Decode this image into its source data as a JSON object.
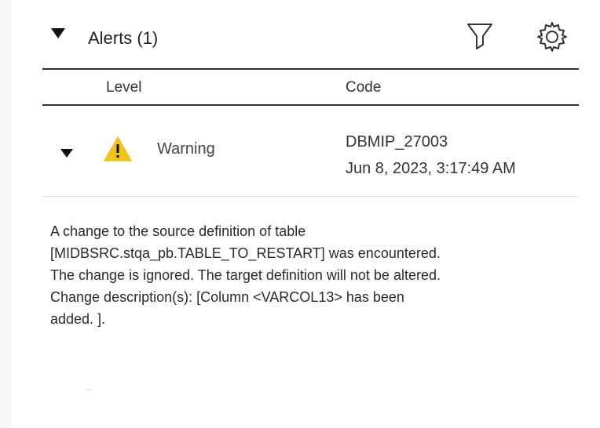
{
  "header": {
    "title": "Alerts (1)",
    "collapse_icon": "caret-down-icon",
    "filter_icon": "filter-icon",
    "settings_icon": "gear-icon"
  },
  "columns": {
    "level": "Level",
    "code": "Code"
  },
  "alerts": [
    {
      "level": "Warning",
      "code": "DBMIP_27003",
      "time": "Jun 8, 2023, 3:17:49 AM",
      "level_icon": "warning-icon",
      "message": "A change to the source definition of table [MIDBSRC.stqa_pb.TABLE_TO_RESTART] was encountered. The change is ignored. The target definition will not be altered. Change description(s): [Column <VARCOL13> has been added. ]."
    }
  ],
  "colors": {
    "warning": "#f0c419",
    "divider": "#333333",
    "text": "#222222"
  }
}
